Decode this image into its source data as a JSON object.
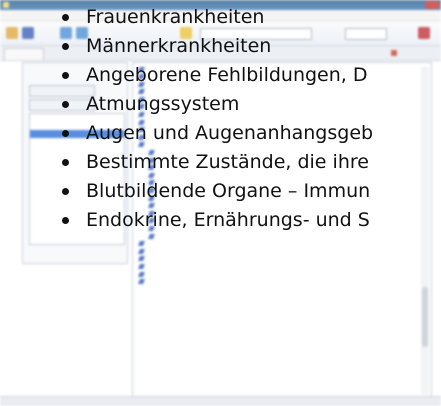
{
  "overlay_items": [
    "Frauenkrankheiten",
    "Männerkrankheiten",
    "Angeborene Fehlbildungen, D",
    "Atmungssystem",
    "Augen und Augenanhangsgeb",
    "Bestimmte Zustände, die ihre",
    "Blutbildende Organe – Immun",
    "Endokrine, Ernährungs- und S"
  ],
  "colors": {
    "selection": "#2a6ed8",
    "link": "#1f3fae",
    "titlebar": "#2c5d8e",
    "close_button": "#c9302c"
  }
}
